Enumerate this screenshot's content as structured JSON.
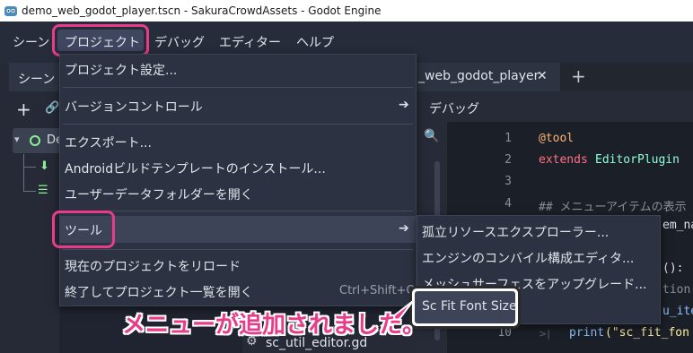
{
  "window": {
    "title": "demo_web_godot_player.tscn - SakuraCrowdAssets - Godot Engine"
  },
  "menubar": {
    "items": [
      "シーン",
      "プロジェクト",
      "デバッグ",
      "エディター",
      "ヘルプ"
    ]
  },
  "left_dock": {
    "tab_label": "シーン",
    "root_node_label": "De"
  },
  "tabs": {
    "active": "_web_godot_player",
    "close": "✕",
    "add": "+"
  },
  "toolbar": {
    "debug_label": "デバッグ"
  },
  "project_menu": {
    "items": [
      "プロジェクト設定...",
      "バージョンコントロール",
      "エクスポート...",
      "Androidビルドテンプレートのインストール...",
      "ユーザーデータフォルダーを開く",
      "ツール",
      "現在のプロジェクトをリロード",
      "終了してプロジェクト一覧を開く"
    ],
    "shortcut": "Ctrl+Shift+Q"
  },
  "tools_submenu": {
    "items": [
      "孤立リソースエクスプローラー...",
      "エンジンのコンバイル構成エディタ...",
      "メッシュサーフェスをアップグレード...",
      "Sc Fit Font Size"
    ]
  },
  "editor": {
    "line_numbers": [
      "1",
      "2",
      "3",
      "4",
      "5",
      "6",
      "7",
      "8",
      "9",
      "10"
    ],
    "code": {
      "l1": "@tool",
      "l2a": "extends",
      "l2b": " EditorPlugin",
      "l4": "## メニューアイテムの表示",
      "l5": "em_na",
      "l7": "():",
      "l8": "tion",
      "l9": "u_ite",
      "l10a": "print",
      "l10b": "(\"sc_fit_fon"
    }
  },
  "file_item": {
    "label": "sc_util_editor.gd"
  },
  "callout": {
    "text": "メニューが追加されました。"
  },
  "colors": {
    "accent": "#e83c8a",
    "menu_bg": "#2c3241",
    "highlight": "#3d4457"
  }
}
